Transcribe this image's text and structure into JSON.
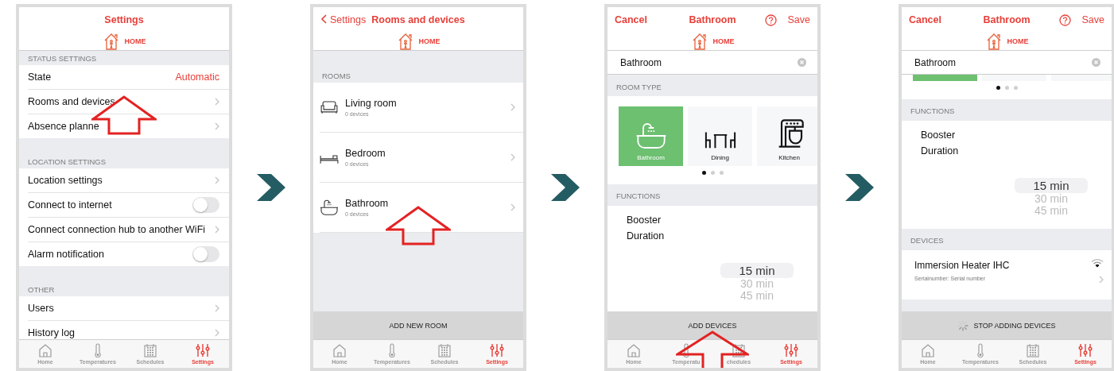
{
  "screens": [
    {
      "header": {
        "title": "Settings"
      },
      "home": "HOME",
      "blocks": [
        {
          "kind": "section",
          "title": "STATUS SETTINGS",
          "rows": [
            {
              "kind": "value",
              "label": "State",
              "value": "Automatic",
              "pointer": false
            },
            {
              "kind": "link",
              "label": "Rooms and devices",
              "pointer": true
            },
            {
              "kind": "link",
              "label": "Absence planne",
              "pointer": false
            }
          ]
        },
        {
          "kind": "section",
          "title": "LOCATION SETTINGS",
          "rows": [
            {
              "kind": "link",
              "label": "Location settings",
              "pointer": false
            },
            {
              "kind": "toggle",
              "label": "Connect to internet",
              "on": false,
              "pointer": false
            },
            {
              "kind": "link",
              "label": "Connect connection hub to another WiFi",
              "pointer": false
            },
            {
              "kind": "toggle",
              "label": "Alarm notification",
              "on": false,
              "pointer": false
            }
          ]
        },
        {
          "kind": "section",
          "title": "OTHER",
          "rows": [
            {
              "kind": "link",
              "label": "Users",
              "pointer": false
            },
            {
              "kind": "link",
              "label": "History log",
              "pointer": false
            }
          ]
        }
      ],
      "tabs": [
        {
          "label": "Home",
          "kind": "home",
          "selected": false
        },
        {
          "label": "Temperatures",
          "kind": "thermometer",
          "selected": false
        },
        {
          "label": "Schedules",
          "kind": "calendar",
          "selected": false
        },
        {
          "label": "Settings",
          "kind": "sliders",
          "selected": true
        }
      ]
    },
    {
      "header": {
        "back": "Settings",
        "title": "Rooms and devices"
      },
      "home": "HOME",
      "blocks": [
        {
          "kind": "rooms",
          "title": "ROOMS",
          "rooms": [
            {
              "name": "Living room",
              "count": "0 devices",
              "kind": "sofa",
              "pointer": false
            },
            {
              "name": "Bedroom",
              "count": "0 devices",
              "kind": "bed",
              "pointer": false
            },
            {
              "name": "Bathroom",
              "count": "0 devices",
              "kind": "bath",
              "pointer": true
            }
          ]
        }
      ],
      "bottom_button": {
        "label": "ADD NEW ROOM",
        "spinner": false,
        "pointer": false
      },
      "tabs": [
        {
          "label": "Home",
          "kind": "home",
          "selected": false
        },
        {
          "label": "Temperatures",
          "kind": "thermometer",
          "selected": false
        },
        {
          "label": "Schedules",
          "kind": "calendar",
          "selected": false
        },
        {
          "label": "Settings",
          "kind": "sliders",
          "selected": true
        }
      ]
    },
    {
      "header": {
        "cancel": "Cancel",
        "title": "Bathroom",
        "help": true,
        "save": "Save"
      },
      "home": "HOME",
      "blocks": [
        {
          "kind": "name_field",
          "value": "Bathroom"
        },
        {
          "kind": "room_types",
          "title": "ROOM TYPE",
          "types": [
            {
              "label": "Bathroom",
              "kind": "bath",
              "selected": true
            },
            {
              "label": "Dining",
              "kind": "dining",
              "selected": false
            },
            {
              "label": "Kitchen",
              "kind": "kitchen",
              "selected": false
            }
          ],
          "pages": [
            {
              "selected": true
            },
            {
              "selected": false
            },
            {
              "selected": false
            }
          ]
        },
        {
          "kind": "functions",
          "title": "FUNCTIONS",
          "label": "Booster Duration",
          "options": [
            {
              "label": "15 min",
              "selected": true
            },
            {
              "label": "30 min",
              "selected": false
            },
            {
              "label": "45 min",
              "selected": false
            }
          ]
        }
      ],
      "bottom_button": {
        "label": "ADD DEVICES",
        "spinner": false,
        "pointer": true
      },
      "tabs": [
        {
          "label": "Home",
          "kind": "home",
          "selected": false
        },
        {
          "label": "Temperatu",
          "kind": "thermometer",
          "selected": false
        },
        {
          "label": "chedules",
          "kind": "calendar",
          "selected": false
        },
        {
          "label": "Settings",
          "kind": "sliders",
          "selected": true
        }
      ]
    },
    {
      "header": {
        "cancel": "Cancel",
        "title": "Bathroom",
        "help": true,
        "save": "Save"
      },
      "home": "HOME",
      "blocks": [
        {
          "kind": "name_field",
          "value": "Bathroom"
        },
        {
          "kind": "room_types_scrolled",
          "types": [
            {
              "selected": true
            },
            {
              "selected": false
            },
            {
              "selected": false
            }
          ],
          "pages": [
            {
              "selected": true
            },
            {
              "selected": false
            },
            {
              "selected": false
            }
          ]
        },
        {
          "kind": "functions",
          "title": "FUNCTIONS",
          "label": "Booster Duration",
          "options": [
            {
              "label": "15 min",
              "selected": true
            },
            {
              "label": "30 min",
              "selected": false
            },
            {
              "label": "45 min",
              "selected": false
            }
          ]
        },
        {
          "kind": "devices",
          "title": "DEVICES",
          "items": [
            {
              "name": "Immersion Heater IHC",
              "serial": "Serialnumber: Serial number"
            }
          ]
        }
      ],
      "bottom_button": {
        "label": "STOP ADDING DEVICES",
        "spinner": true,
        "pointer": false
      },
      "tabs": [
        {
          "label": "Home",
          "kind": "home",
          "selected": false
        },
        {
          "label": "Temperatures",
          "kind": "thermometer",
          "selected": false
        },
        {
          "label": "Schedules",
          "kind": "calendar",
          "selected": false
        },
        {
          "label": "Settings",
          "kind": "sliders",
          "selected": true
        }
      ]
    }
  ]
}
